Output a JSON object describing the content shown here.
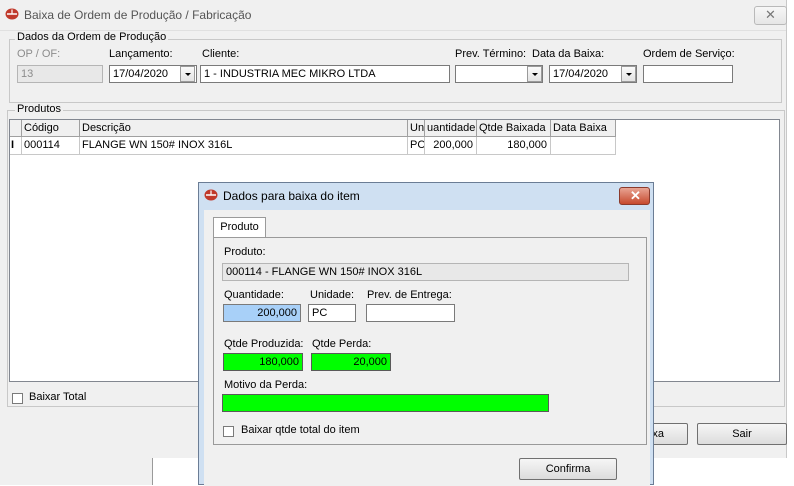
{
  "window": {
    "title": "Baixa de Ordem de Produção / Fabricação",
    "close_glyph": "✕"
  },
  "order_group": {
    "title": "Dados da Ordem de Produção",
    "op_label": "OP / OF:",
    "op_value": "13",
    "lancamento_label": "Lançamento:",
    "lancamento_value": "17/04/2020",
    "cliente_label": "Cliente:",
    "cliente_value": "1 - INDUSTRIA MEC MIKRO LTDA",
    "prev_termino_label": "Prev. Término:",
    "prev_termino_value": "",
    "data_baixa_label": "Data da Baixa:",
    "data_baixa_value": "17/04/2020",
    "ordem_servico_label": "Ordem de Serviço:",
    "ordem_servico_value": ""
  },
  "products_group": {
    "title": "Produtos",
    "columns": [
      "Código",
      "Descrição",
      "Un",
      "Quantidade",
      "Qtde Baixada",
      "Data Baixa"
    ],
    "header_visible": [
      "Código",
      "Descrição",
      "Un",
      "uantidade",
      "Qtde Baixada",
      "Data Baixa"
    ],
    "rows": [
      {
        "indicator": "I",
        "codigo": "000114",
        "descricao": "FLANGE WN 150# INOX 316L",
        "un": "PC",
        "quantidade": "200,000",
        "qtde_baixada": "180,000",
        "data_baixa": ""
      }
    ]
  },
  "bottom": {
    "baixar_total_label": "Baixar Total",
    "baixar_total_checked": false,
    "baixa_button_partial": "xa",
    "sair_button": "Sair"
  },
  "dialog": {
    "title": "Dados para baixa do item",
    "close_glyph": "✕",
    "tab_label": "Produto",
    "produto_label": "Produto:",
    "produto_value": "000114 - FLANGE WN 150# INOX 316L",
    "quantidade_label": "Quantidade:",
    "quantidade_value": "200,000",
    "unidade_label": "Unidade:",
    "unidade_value": "PC",
    "prev_entrega_label": "Prev. de Entrega:",
    "prev_entrega_value": "",
    "qtde_produzida_label": "Qtde Produzida:",
    "qtde_produzida_value": "180,000",
    "qtde_perda_label": "Qtde Perda:",
    "qtde_perda_value": "20,000",
    "motivo_perda_label": "Motivo da Perda:",
    "motivo_perda_value": "",
    "baixar_qtde_total_label": "Baixar qtde total do item",
    "baixar_qtde_total_checked": false,
    "confirma_button": "Confirma"
  },
  "colors": {
    "highlight_green": "#00ff00",
    "highlight_blue": "#a8d0f8",
    "dialog_frame": "#cfe0f2",
    "close_red": "#c74a2e"
  }
}
